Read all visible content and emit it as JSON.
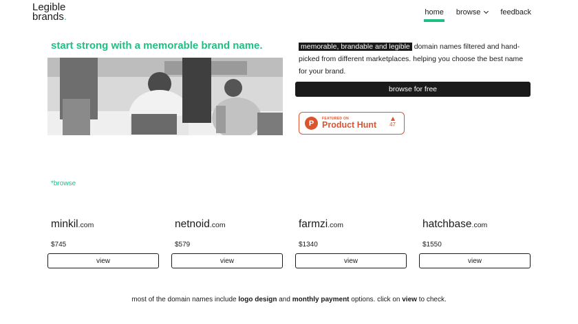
{
  "header": {
    "logo_line1": "Legible",
    "logo_line2": "brands",
    "logo_dot": ".",
    "nav": {
      "home": "home",
      "browse": "browse",
      "feedback": "feedback"
    }
  },
  "hero": {
    "tagline": "start strong with a memorable brand name.",
    "highlight": "memorable, brandable and legible",
    "description": " domain names filtered and hand-picked from different marketplaces. helping you choose the best name for your brand.",
    "browse_button": "browse for free"
  },
  "product_hunt": {
    "featured": "FEATURED ON",
    "name": "Product Hunt",
    "logo_letter": "P",
    "votes": "47"
  },
  "browse_link": "*browse",
  "domains": [
    {
      "name": "minkil",
      "tld": ".com",
      "price": "$745",
      "button": "view"
    },
    {
      "name": "netnoid",
      "tld": ".com",
      "price": "$579",
      "button": "view"
    },
    {
      "name": "farmzi",
      "tld": ".com",
      "price": "$1340",
      "button": "view"
    },
    {
      "name": "hatchbase",
      "tld": ".com",
      "price": "$1550",
      "button": "view"
    }
  ],
  "footer": {
    "part1": "most of the domain names include ",
    "bold1": "logo design",
    "part2": " and ",
    "bold2": "monthly payment",
    "part3": " options. click on ",
    "bold3": "view",
    "part4": " to check."
  },
  "colors": {
    "accent": "#1fbf83",
    "dark": "#1a1a1a",
    "product_hunt": "#da552f"
  }
}
